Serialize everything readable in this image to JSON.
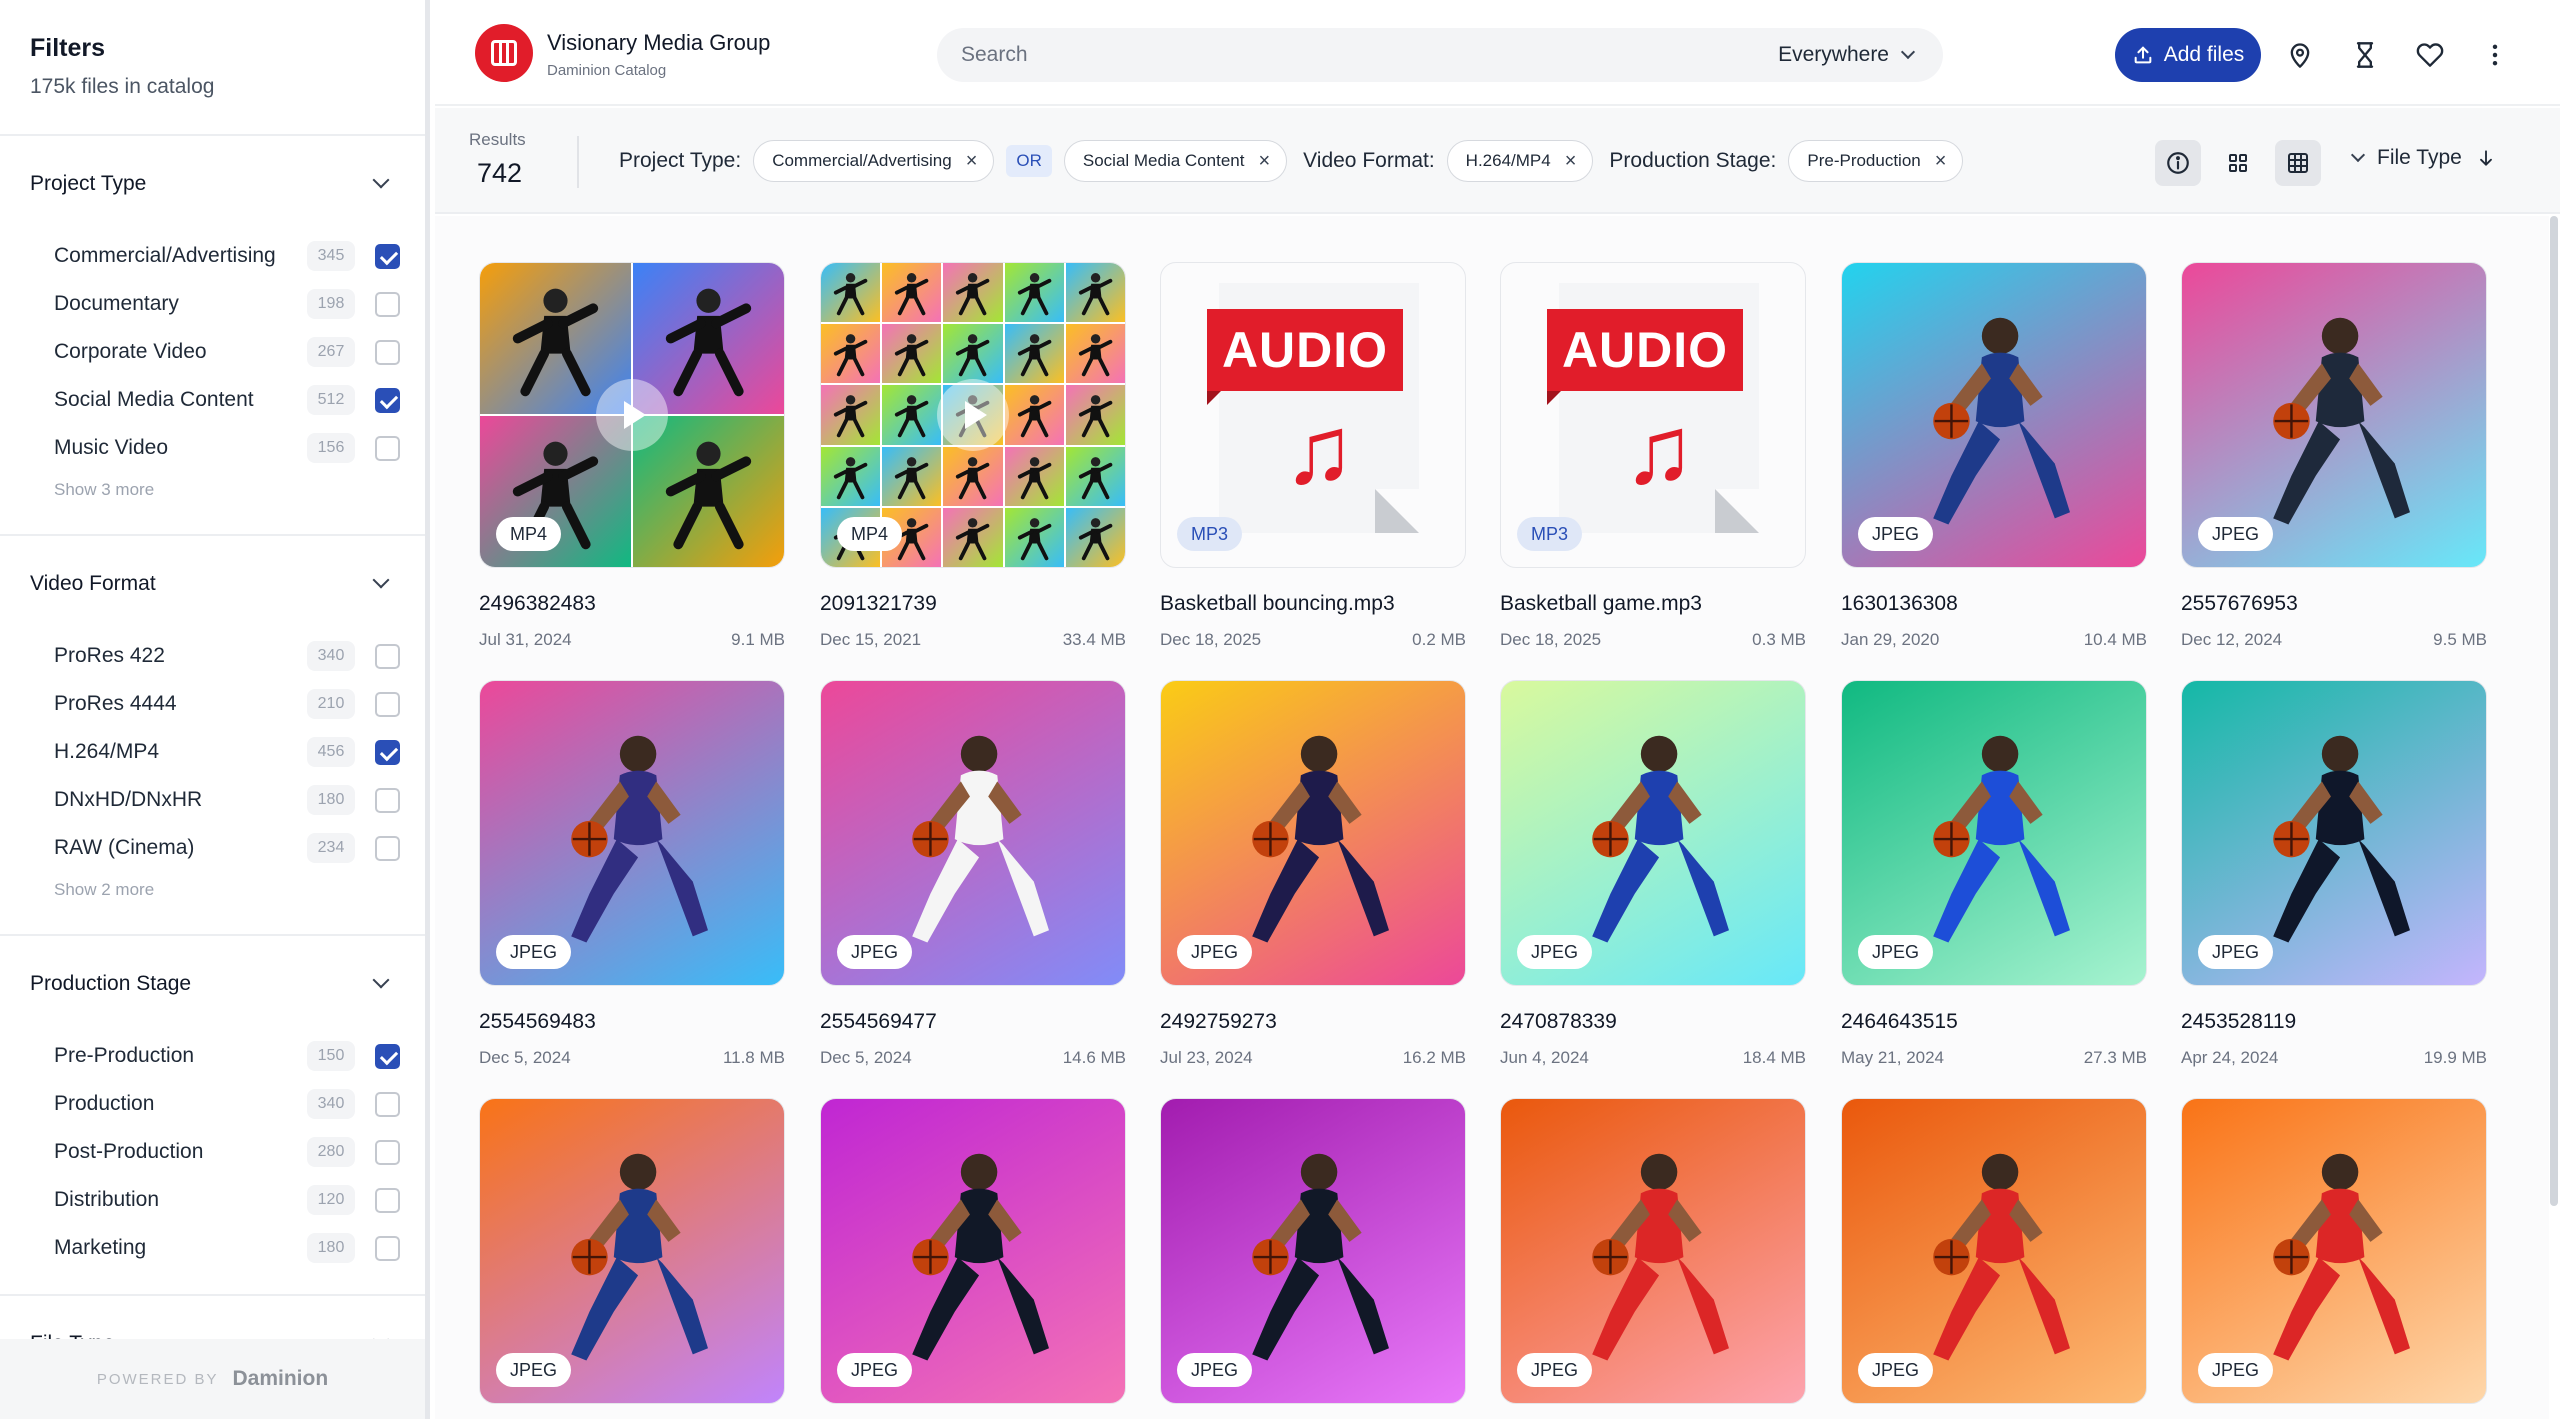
{
  "sidebar": {
    "title": "Filters",
    "subtitle": "175k files in catalog",
    "sections": [
      {
        "title": "Project Type",
        "items": [
          {
            "label": "Commercial/Advertising",
            "count": "345",
            "checked": true
          },
          {
            "label": "Documentary",
            "count": "198",
            "checked": false
          },
          {
            "label": "Corporate Video",
            "count": "267",
            "checked": false
          },
          {
            "label": "Social Media Content",
            "count": "512",
            "checked": true
          },
          {
            "label": "Music Video",
            "count": "156",
            "checked": false
          }
        ],
        "more": "Show 3 more"
      },
      {
        "title": "Video Format",
        "items": [
          {
            "label": "ProRes 422",
            "count": "340",
            "checked": false
          },
          {
            "label": "ProRes 4444",
            "count": "210",
            "checked": false
          },
          {
            "label": "H.264/MP4",
            "count": "456",
            "checked": true
          },
          {
            "label": "DNxHD/DNxHR",
            "count": "180",
            "checked": false
          },
          {
            "label": "RAW (Cinema)",
            "count": "234",
            "checked": false
          }
        ],
        "more": "Show 2 more"
      },
      {
        "title": "Production Stage",
        "items": [
          {
            "label": "Pre-Production",
            "count": "150",
            "checked": true
          },
          {
            "label": "Production",
            "count": "340",
            "checked": false
          },
          {
            "label": "Post-Production",
            "count": "280",
            "checked": false
          },
          {
            "label": "Distribution",
            "count": "120",
            "checked": false
          },
          {
            "label": "Marketing",
            "count": "180",
            "checked": false
          }
        ],
        "more": ""
      },
      {
        "title": "File Type",
        "items": [],
        "more": ""
      }
    ],
    "footer": {
      "powered": "POWERED BY",
      "brand": "Daminion"
    }
  },
  "header": {
    "org_name": "Visionary Media Group",
    "org_sub": "Daminion Catalog",
    "search_placeholder": "Search",
    "scope": "Everywhere",
    "add_files": "Add files",
    "icons": [
      "location-pin-icon",
      "hourglass-icon",
      "heart-icon",
      "more-vertical-icon"
    ]
  },
  "filter_bar": {
    "results_label": "Results",
    "results_count": "742",
    "project_type_label": "Project Type:",
    "project_type_chips": [
      "Commercial/Advertising",
      "Social Media Content"
    ],
    "or_label": "OR",
    "video_format_label": "Video Format:",
    "video_format_chips": [
      "H.264/MP4"
    ],
    "production_stage_label": "Production Stage:",
    "production_stage_chips": [
      "Pre-Production"
    ],
    "sort_label": "File Type"
  },
  "colors": {
    "accent": "#1e40af",
    "brand_red": "#e11d2a",
    "checkbox": "#2a4fb7"
  },
  "files": [
    {
      "name": "2496382483",
      "date": "Jul 31, 2024",
      "size": "9.1 MB",
      "type": "MP4",
      "kind": "video-mosaic",
      "bg": [
        "#f59e0b",
        "#3b82f6",
        "#ec4899",
        "#10b981"
      ]
    },
    {
      "name": "2091321739",
      "date": "Dec 15, 2021",
      "size": "33.4 MB",
      "type": "MP4",
      "kind": "video-mosaic2",
      "bg": [
        "#38bdf8",
        "#fbbf24",
        "#f472b6",
        "#a3e635"
      ]
    },
    {
      "name": "Basketball bouncing.mp3",
      "date": "Dec 18, 2025",
      "size": "0.2 MB",
      "type": "MP3",
      "kind": "audio",
      "audio_label": "AUDIO"
    },
    {
      "name": "Basketball game.mp3",
      "date": "Dec 18, 2025",
      "size": "0.3 MB",
      "type": "MP3",
      "kind": "audio",
      "audio_label": "AUDIO"
    },
    {
      "name": "1630136308",
      "date": "Jan 29, 2020",
      "size": "10.4 MB",
      "type": "JPEG",
      "kind": "photo",
      "bg": [
        "#22d3ee",
        "#ec4899"
      ],
      "fig": "#1e3a8a"
    },
    {
      "name": "2557676953",
      "date": "Dec 12, 2024",
      "size": "9.5 MB",
      "type": "JPEG",
      "kind": "photo",
      "bg": [
        "#ec4899",
        "#67e8f9"
      ],
      "fig": "#1e293b"
    },
    {
      "name": "2554569483",
      "date": "Dec 5, 2024",
      "size": "11.8 MB",
      "type": "JPEG",
      "kind": "photo",
      "bg": [
        "#ec4899",
        "#38bdf8"
      ],
      "fig": "#312e81"
    },
    {
      "name": "2554569477",
      "date": "Dec 5, 2024",
      "size": "14.6 MB",
      "type": "JPEG",
      "kind": "photo",
      "bg": [
        "#ec4899",
        "#818cf8"
      ],
      "fig": "#f5f5f5"
    },
    {
      "name": "2492759273",
      "date": "Jul 23, 2024",
      "size": "16.2 MB",
      "type": "JPEG",
      "kind": "photo",
      "bg": [
        "#facc15",
        "#ec4899"
      ],
      "fig": "#1e1b4b"
    },
    {
      "name": "2470878339",
      "date": "Jun 4, 2024",
      "size": "18.4 MB",
      "type": "JPEG",
      "kind": "photo",
      "bg": [
        "#d9f99d",
        "#67e8f9"
      ],
      "fig": "#1e40af"
    },
    {
      "name": "2464643515",
      "date": "May 21, 2024",
      "size": "27.3 MB",
      "type": "JPEG",
      "kind": "photo",
      "bg": [
        "#10b981",
        "#a7f3d0"
      ],
      "fig": "#1d4ed8"
    },
    {
      "name": "2453528119",
      "date": "Apr 24, 2024",
      "size": "19.9 MB",
      "type": "JPEG",
      "kind": "photo",
      "bg": [
        "#14b8a6",
        "#c4b5fd"
      ],
      "fig": "#0f172a"
    },
    {
      "name": "",
      "date": "",
      "size": "",
      "type": "JPEG",
      "kind": "photo",
      "bg": [
        "#f97316",
        "#c084fc"
      ],
      "fig": "#1e3a8a"
    },
    {
      "name": "",
      "date": "",
      "size": "",
      "type": "JPEG",
      "kind": "photo",
      "bg": [
        "#c026d3",
        "#f472b6"
      ],
      "fig": "#111827"
    },
    {
      "name": "",
      "date": "",
      "size": "",
      "type": "JPEG",
      "kind": "photo",
      "bg": [
        "#a21caf",
        "#e879f9"
      ],
      "fig": "#111827"
    },
    {
      "name": "",
      "date": "",
      "size": "",
      "type": "JPEG",
      "kind": "photo",
      "bg": [
        "#ea580c",
        "#fda4af"
      ],
      "fig": "#dc2626"
    },
    {
      "name": "",
      "date": "",
      "size": "",
      "type": "JPEG",
      "kind": "photo",
      "bg": [
        "#ea580c",
        "#fdba74"
      ],
      "fig": "#dc2626"
    },
    {
      "name": "",
      "date": "",
      "size": "",
      "type": "JPEG",
      "kind": "photo",
      "bg": [
        "#f97316",
        "#fed7aa"
      ],
      "fig": "#dc2626"
    }
  ]
}
